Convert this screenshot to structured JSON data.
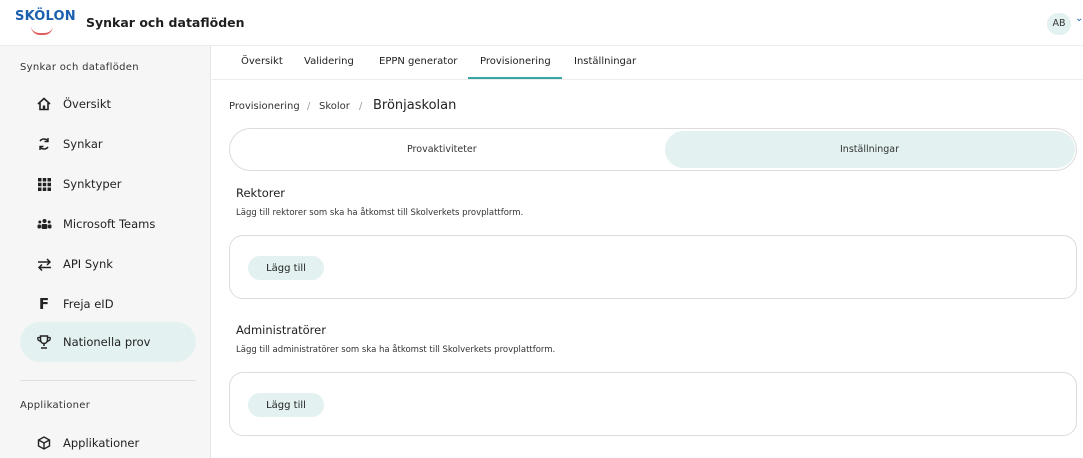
{
  "header": {
    "logo_text": "SKÖLON",
    "app_title": "Synkar och dataflöden",
    "avatar_initials": "AB"
  },
  "sidebar": {
    "section1": "Synkar och dataflöden",
    "items": [
      {
        "label": "Översikt",
        "icon": "home-icon"
      },
      {
        "label": "Synkar",
        "icon": "sync-icon"
      },
      {
        "label": "Synktyper",
        "icon": "grid-icon"
      },
      {
        "label": "Microsoft Teams",
        "icon": "people-icon"
      },
      {
        "label": "API Synk",
        "icon": "swap-arrows-icon"
      },
      {
        "label": "Freja eID",
        "icon": "freja-f-icon"
      },
      {
        "label": "Nationella prov",
        "icon": "trophy-icon"
      }
    ],
    "section2": "Applikationer",
    "app_item": {
      "label": "Applikationer",
      "icon": "cube-icon"
    }
  },
  "tabs": [
    "Översikt",
    "Validering",
    "EPPN generator",
    "Provisionering",
    "Inställningar"
  ],
  "active_tab": "Provisionering",
  "breadcrumb": {
    "level1": "Provisionering",
    "level2": "Skolor",
    "current": "Brönjaskolan",
    "separator": "/"
  },
  "segment": {
    "left": "Provaktiviteter",
    "right": "Inställningar",
    "selected": "Inställningar"
  },
  "rektorer": {
    "title": "Rektorer",
    "description": "Lägg till rektorer som ska ha åtkomst till Skolverkets provplattform.",
    "button": "Lägg till"
  },
  "administratorer": {
    "title": "Administratörer",
    "description": "Lägg till administratörer som ska ha åtkomst till Skolverkets provplattform.",
    "button": "Lägg till"
  },
  "colors": {
    "accent": "#3aa3a3",
    "active_bg": "#e3f1f1",
    "brand_blue": "#1c5fae",
    "brand_red": "#e25e5e"
  }
}
